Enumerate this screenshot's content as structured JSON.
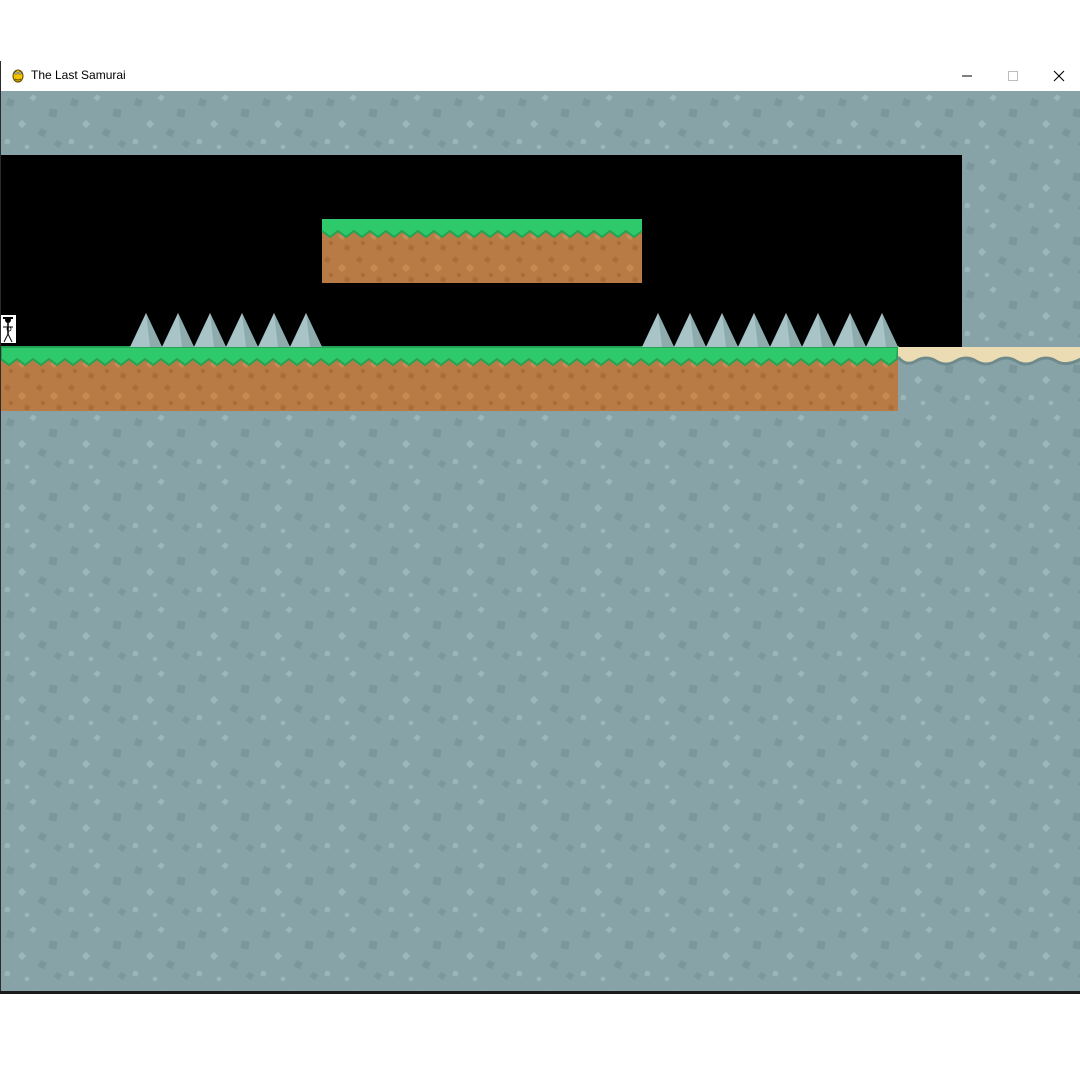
{
  "window": {
    "title": "The Last Samurai",
    "icon": "pygame-snake-icon",
    "controls": {
      "minimize_icon": "minimize-icon",
      "maximize_icon": "maximize-icon",
      "close_icon": "close-icon"
    }
  },
  "game": {
    "background_color": "#87a3a7",
    "void_color": "#000000",
    "grass_color": "#2ec96a",
    "dirt_color": "#b87b45",
    "sand_color": "#ecdcb4",
    "spike_color": "#a9c4c6",
    "spike_groups": [
      {
        "name": "left-spikes",
        "count": 6
      },
      {
        "name": "right-spikes",
        "count": 8
      }
    ],
    "player": {
      "name": "samurai-player"
    }
  }
}
